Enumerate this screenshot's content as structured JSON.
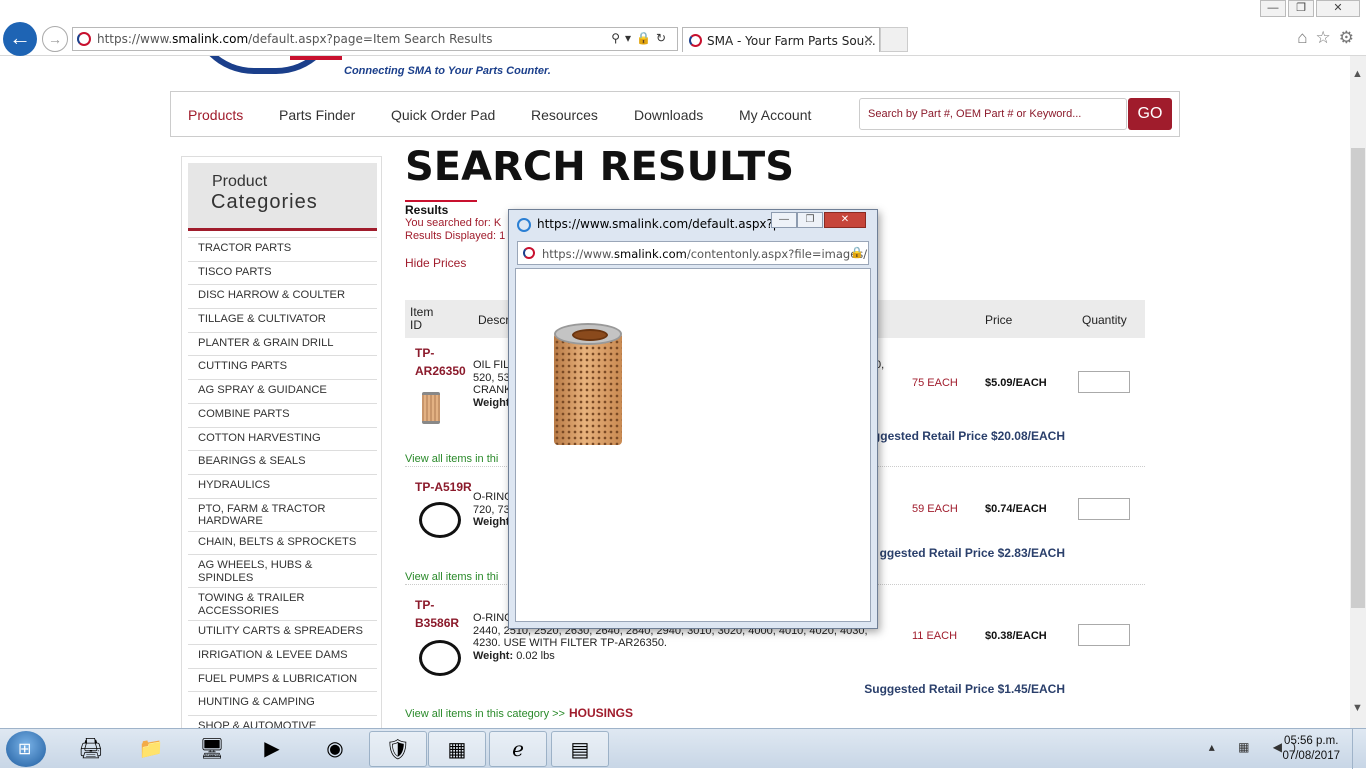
{
  "browser": {
    "address_url_prefix": "https://www.",
    "address_url_domain": "smalink.com",
    "address_url_rest": "/default.aspx?page=Item Search Results",
    "tab_title": "SMA - Your Farm Parts Sou...",
    "tab_close": "✕",
    "window_buttons": [
      "—",
      "❐",
      "✕"
    ],
    "back": "←",
    "forward": "→",
    "addr_tools": "⚲▾🔒↻",
    "chrome_icons": "⌂☆⚙"
  },
  "site": {
    "tagline": "Connecting SMA to Your Parts Counter.",
    "menu": [
      "Products",
      "Parts Finder",
      "Quick Order Pad",
      "Resources",
      "Downloads",
      "My Account"
    ],
    "search_placeholder": "Search by Part #, OEM Part # or Keyword...",
    "go_label": "GO"
  },
  "sidebar": {
    "title_line1": "Product",
    "title_line2": "Categories",
    "items": [
      "TRACTOR PARTS",
      "TISCO PARTS",
      "DISC HARROW & COULTER",
      "TILLAGE & CULTIVATOR",
      "PLANTER & GRAIN DRILL",
      "CUTTING PARTS",
      "AG SPRAY & GUIDANCE",
      "COMBINE PARTS",
      "COTTON HARVESTING",
      "BEARINGS & SEALS",
      "HYDRAULICS",
      "PTO, FARM & TRACTOR HARDWARE",
      "CHAIN, BELTS & SPROCKETS",
      "AG WHEELS, HUBS & SPINDLES",
      "TOWING & TRAILER ACCESSORIES",
      "UTILITY CARTS & SPREADERS",
      "IRRIGATION & LEVEE DAMS",
      "FUEL PUMPS & LUBRICATION",
      "HUNTING & CAMPING",
      "SHOP & AUTOMOTIVE"
    ]
  },
  "main": {
    "heading": "SEARCH RESULTS",
    "results_label": "Results",
    "searched_for": "You searched for: K",
    "displayed": "Results Displayed: 1",
    "hide_prices": "Hide Prices",
    "columns": {
      "item_id_1": "Item",
      "item_id_2": "ID",
      "description": "Descr",
      "price": "Price",
      "quantity": "Quantity"
    },
    "rows": [
      {
        "id_line1": "TP-",
        "id_line2": "AR26350",
        "desc_l1": "OIL FIL",
        "desc_l1b": "0,",
        "desc_l2": "520, 53",
        "desc_l3": "CRANK",
        "weight_label": "Weight",
        "stock": "75 EACH",
        "price": "$5.09/EACH",
        "msrp": "ggested Retail Price $20.08/EACH",
        "view_all": "View all items in thi"
      },
      {
        "id_line1": "TP-A519R",
        "desc_l1": "O-RING",
        "desc_l1b": ",",
        "desc_l2": "720, 73",
        "weight_label": "Weight",
        "stock": "59 EACH",
        "price": "$0.74/EACH",
        "msrp": "ggested Retail Price $2.83/EACH",
        "view_all": "View all items in thi"
      },
      {
        "id_line1": "TP-",
        "id_line2": "B3586R",
        "desc_l1": "O-RING",
        "desc_l2": "2440, 2510, 2520, 2630, 2640, 2840, 2940, 3010, 3020, 4000, 4010, 4020, 4030,",
        "desc_l3": "4230. USE WITH FILTER TP-AR26350.",
        "weight_label": "Weight:",
        "weight_value": "0.02 lbs",
        "stock": "11 EACH",
        "price": "$0.38/EACH",
        "msrp": "Suggested Retail Price $1.45/EACH",
        "view_all": "View all items in this category >>",
        "view_all_category": "HOUSINGS"
      }
    ]
  },
  "popup": {
    "title": "https://www.smalink.com/default.aspx?pa...",
    "url_prefix": "https://www.",
    "url_domain": "smalink.com",
    "url_rest": "/contentonly.aspx?file=images/",
    "buttons": [
      "—",
      "❐",
      "✕"
    ],
    "lock": "🔒"
  },
  "taskbar": {
    "start": "⊞",
    "tray": "▴ ▦ ◀)",
    "time": "05:56 p.m.",
    "date": "07/08/2017"
  },
  "colors": {
    "brand_red": "#a01c2c",
    "brand_blue": "#1b3f8b",
    "link_green": "#2a8a2a",
    "msrp_blue": "#2a3f6b"
  }
}
